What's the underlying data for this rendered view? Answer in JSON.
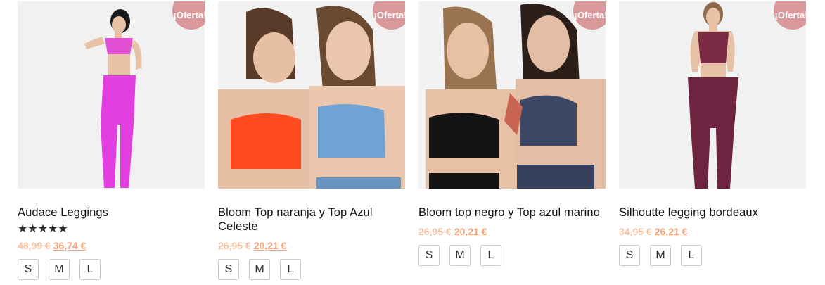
{
  "products": [
    {
      "title": "Audace Leggings",
      "rating_stars": "★★★★★",
      "rating": 5,
      "old_price": "48,99 €",
      "new_price": "36,74 €",
      "badge": "¡Oferta!",
      "sizes": [
        "S",
        "M",
        "L"
      ]
    },
    {
      "title": "Bloom Top naranja y Top Azul Celeste",
      "old_price": "26,95 €",
      "new_price": "20,21 €",
      "badge": "¡Oferta!",
      "sizes": [
        "S",
        "M",
        "L"
      ]
    },
    {
      "title": "Bloom top negro y Top azul marino",
      "old_price": "26,95 €",
      "new_price": "20,21 €",
      "badge": "¡Oferta!",
      "sizes": [
        "S",
        "M",
        "L"
      ]
    },
    {
      "title": "Silhoutte legging bordeaux",
      "old_price": "34,95 €",
      "new_price": "26,21 €",
      "badge": "¡Oferta!",
      "sizes": [
        "S",
        "M",
        "L"
      ]
    }
  ],
  "colors": {
    "badge": "#d9989a",
    "old_price": "#f2c2a7",
    "new_price": "#f0a37a",
    "stars": "#2f3136"
  }
}
